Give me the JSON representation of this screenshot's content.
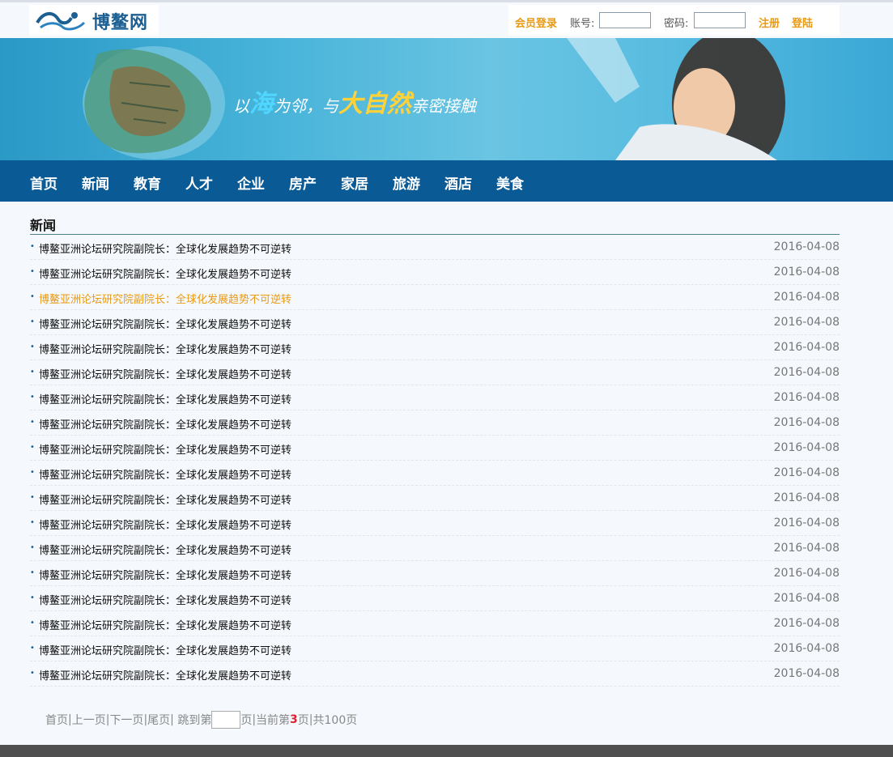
{
  "header": {
    "logo_text": "博鳌网",
    "login": {
      "label": "会员登录",
      "account_label": "账号:",
      "account_value": "",
      "password_label": "密码:",
      "password_value": "",
      "register": "注册",
      "signin": "登陆"
    }
  },
  "banner": {
    "slogan_parts": [
      "以",
      "海",
      "为邻，与",
      "大自然",
      "亲密接触"
    ]
  },
  "nav": [
    "首页",
    "新闻",
    "教育",
    "人才",
    "企业",
    "房产",
    "家居",
    "旅游",
    "酒店",
    "美食"
  ],
  "section": {
    "title": "新闻"
  },
  "news": [
    {
      "title": "博鳌亚洲论坛研究院副院长：全球化发展趋势不可逆转",
      "date": "2016-04-08"
    },
    {
      "title": "博鳌亚洲论坛研究院副院长：全球化发展趋势不可逆转",
      "date": "2016-04-08"
    },
    {
      "title": "博鳌亚洲论坛研究院副院长：全球化发展趋势不可逆转",
      "date": "2016-04-08",
      "hover": true
    },
    {
      "title": "博鳌亚洲论坛研究院副院长：全球化发展趋势不可逆转",
      "date": "2016-04-08"
    },
    {
      "title": "博鳌亚洲论坛研究院副院长：全球化发展趋势不可逆转",
      "date": "2016-04-08"
    },
    {
      "title": "博鳌亚洲论坛研究院副院长：全球化发展趋势不可逆转",
      "date": "2016-04-08"
    },
    {
      "title": "博鳌亚洲论坛研究院副院长：全球化发展趋势不可逆转",
      "date": "2016-04-08"
    },
    {
      "title": "博鳌亚洲论坛研究院副院长：全球化发展趋势不可逆转",
      "date": "2016-04-08"
    },
    {
      "title": "博鳌亚洲论坛研究院副院长：全球化发展趋势不可逆转",
      "date": "2016-04-08"
    },
    {
      "title": "博鳌亚洲论坛研究院副院长：全球化发展趋势不可逆转",
      "date": "2016-04-08"
    },
    {
      "title": "博鳌亚洲论坛研究院副院长：全球化发展趋势不可逆转",
      "date": "2016-04-08"
    },
    {
      "title": "博鳌亚洲论坛研究院副院长：全球化发展趋势不可逆转",
      "date": "2016-04-08"
    },
    {
      "title": "博鳌亚洲论坛研究院副院长：全球化发展趋势不可逆转",
      "date": "2016-04-08"
    },
    {
      "title": "博鳌亚洲论坛研究院副院长：全球化发展趋势不可逆转",
      "date": "2016-04-08"
    },
    {
      "title": "博鳌亚洲论坛研究院副院长：全球化发展趋势不可逆转",
      "date": "2016-04-08"
    },
    {
      "title": "博鳌亚洲论坛研究院副院长：全球化发展趋势不可逆转",
      "date": "2016-04-08"
    },
    {
      "title": "博鳌亚洲论坛研究院副院长：全球化发展趋势不可逆转",
      "date": "2016-04-08"
    },
    {
      "title": "博鳌亚洲论坛研究院副院长：全球化发展趋势不可逆转",
      "date": "2016-04-08"
    }
  ],
  "pager": {
    "first": "首页",
    "prev": "上一页",
    "next": "下一页",
    "last": "尾页",
    "jump_prefix": "跳到第",
    "jump_value": "",
    "jump_suffix": "页",
    "current_prefix": "当前第",
    "current": "3",
    "current_suffix": "页",
    "total": "共100页"
  },
  "colors": {
    "nav_bg": "#0a5a96",
    "accent": "#e89a14",
    "brand": "#1c5f93"
  }
}
